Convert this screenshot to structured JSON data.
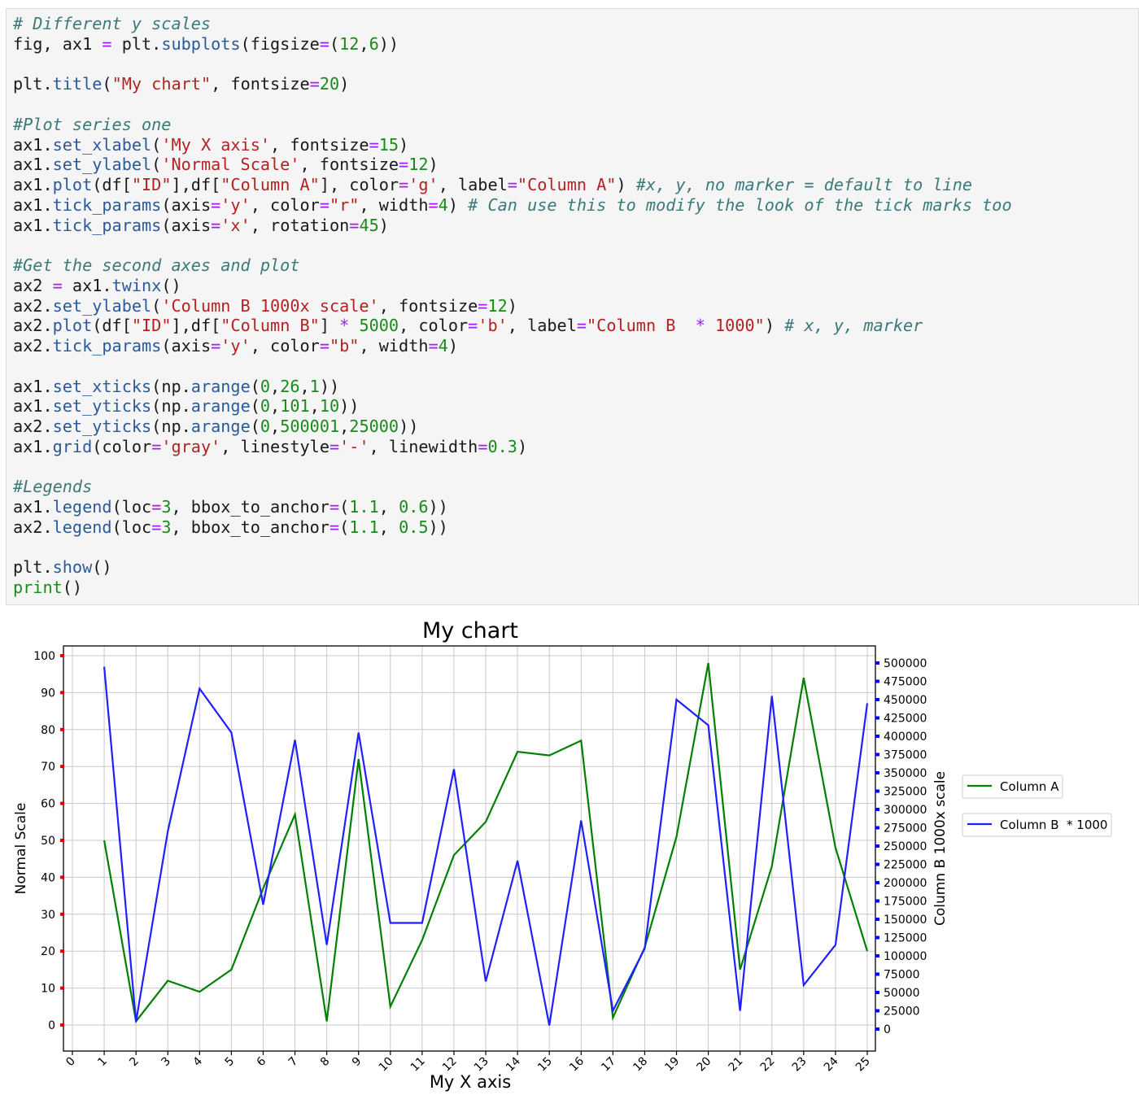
{
  "code_lines": [
    [
      [
        "cm",
        "# Different y scales"
      ]
    ],
    [
      [
        "tx",
        "fig, ax1 "
      ],
      [
        "op",
        "="
      ],
      [
        "tx",
        " plt."
      ],
      [
        "fn",
        "subplots"
      ],
      [
        "tx",
        "(figsize"
      ],
      [
        "op",
        "="
      ],
      [
        "tx",
        "("
      ],
      [
        "nm",
        "12"
      ],
      [
        "tx",
        ","
      ],
      [
        "nm",
        "6"
      ],
      [
        "tx",
        "))"
      ]
    ],
    [
      [
        "tx",
        ""
      ]
    ],
    [
      [
        "tx",
        "plt."
      ],
      [
        "fn",
        "title"
      ],
      [
        "tx",
        "("
      ],
      [
        "st",
        "\"My chart\""
      ],
      [
        "tx",
        ", fontsize"
      ],
      [
        "op",
        "="
      ],
      [
        "nm",
        "20"
      ],
      [
        "tx",
        ")"
      ]
    ],
    [
      [
        "tx",
        ""
      ]
    ],
    [
      [
        "cm",
        "#Plot series one"
      ]
    ],
    [
      [
        "tx",
        "ax1."
      ],
      [
        "fn",
        "set_xlabel"
      ],
      [
        "tx",
        "("
      ],
      [
        "st",
        "'My X axis'"
      ],
      [
        "tx",
        ", fontsize"
      ],
      [
        "op",
        "="
      ],
      [
        "nm",
        "15"
      ],
      [
        "tx",
        ")"
      ]
    ],
    [
      [
        "tx",
        "ax1."
      ],
      [
        "fn",
        "set_ylabel"
      ],
      [
        "tx",
        "("
      ],
      [
        "st",
        "'Normal Scale'"
      ],
      [
        "tx",
        ", fontsize"
      ],
      [
        "op",
        "="
      ],
      [
        "nm",
        "12"
      ],
      [
        "tx",
        ")"
      ]
    ],
    [
      [
        "tx",
        "ax1."
      ],
      [
        "fn",
        "plot"
      ],
      [
        "tx",
        "(df["
      ],
      [
        "st",
        "\"ID\""
      ],
      [
        "tx",
        "],df["
      ],
      [
        "st",
        "\"Column A\""
      ],
      [
        "tx",
        "], color"
      ],
      [
        "op",
        "="
      ],
      [
        "st",
        "'g'"
      ],
      [
        "tx",
        ", label"
      ],
      [
        "op",
        "="
      ],
      [
        "st",
        "\"Column A\""
      ],
      [
        "tx",
        ") "
      ],
      [
        "cm",
        "#x, y, no marker = default to line"
      ]
    ],
    [
      [
        "tx",
        "ax1."
      ],
      [
        "fn",
        "tick_params"
      ],
      [
        "tx",
        "(axis"
      ],
      [
        "op",
        "="
      ],
      [
        "st",
        "'y'"
      ],
      [
        "tx",
        ", color"
      ],
      [
        "op",
        "="
      ],
      [
        "st",
        "\"r\""
      ],
      [
        "tx",
        ", width"
      ],
      [
        "op",
        "="
      ],
      [
        "nm",
        "4"
      ],
      [
        "tx",
        ") "
      ],
      [
        "cm",
        "# Can use this to modify the look of the tick marks too"
      ]
    ],
    [
      [
        "tx",
        "ax1."
      ],
      [
        "fn",
        "tick_params"
      ],
      [
        "tx",
        "(axis"
      ],
      [
        "op",
        "="
      ],
      [
        "st",
        "'x'"
      ],
      [
        "tx",
        ", rotation"
      ],
      [
        "op",
        "="
      ],
      [
        "nm",
        "45"
      ],
      [
        "tx",
        ")"
      ]
    ],
    [
      [
        "tx",
        ""
      ]
    ],
    [
      [
        "cm",
        "#Get the second axes and plot"
      ]
    ],
    [
      [
        "tx",
        "ax2 "
      ],
      [
        "op",
        "="
      ],
      [
        "tx",
        " ax1."
      ],
      [
        "fn",
        "twinx"
      ],
      [
        "tx",
        "()"
      ]
    ],
    [
      [
        "tx",
        "ax2."
      ],
      [
        "fn",
        "set_ylabel"
      ],
      [
        "tx",
        "("
      ],
      [
        "st",
        "'Column B 1000x scale'"
      ],
      [
        "tx",
        ", fontsize"
      ],
      [
        "op",
        "="
      ],
      [
        "nm",
        "12"
      ],
      [
        "tx",
        ")"
      ]
    ],
    [
      [
        "tx",
        "ax2."
      ],
      [
        "fn",
        "plot"
      ],
      [
        "tx",
        "(df["
      ],
      [
        "st",
        "\"ID\""
      ],
      [
        "tx",
        "],df["
      ],
      [
        "st",
        "\"Column B\""
      ],
      [
        "tx",
        "] "
      ],
      [
        "op",
        "*"
      ],
      [
        "tx",
        " "
      ],
      [
        "nm",
        "5000"
      ],
      [
        "tx",
        ", color"
      ],
      [
        "op",
        "="
      ],
      [
        "st",
        "'b'"
      ],
      [
        "tx",
        ", label"
      ],
      [
        "op",
        "="
      ],
      [
        "st",
        "\"Column B  "
      ],
      [
        "op",
        "*"
      ],
      [
        "st",
        " 1000\""
      ],
      [
        "tx",
        ") "
      ],
      [
        "cm",
        "# x, y, marker"
      ]
    ],
    [
      [
        "tx",
        "ax2."
      ],
      [
        "fn",
        "tick_params"
      ],
      [
        "tx",
        "(axis"
      ],
      [
        "op",
        "="
      ],
      [
        "st",
        "'y'"
      ],
      [
        "tx",
        ", color"
      ],
      [
        "op",
        "="
      ],
      [
        "st",
        "\"b\""
      ],
      [
        "tx",
        ", width"
      ],
      [
        "op",
        "="
      ],
      [
        "nm",
        "4"
      ],
      [
        "tx",
        ")"
      ]
    ],
    [
      [
        "tx",
        ""
      ]
    ],
    [
      [
        "tx",
        "ax1."
      ],
      [
        "fn",
        "set_xticks"
      ],
      [
        "tx",
        "(np."
      ],
      [
        "fn",
        "arange"
      ],
      [
        "tx",
        "("
      ],
      [
        "nm",
        "0"
      ],
      [
        "tx",
        ","
      ],
      [
        "nm",
        "26"
      ],
      [
        "tx",
        ","
      ],
      [
        "nm",
        "1"
      ],
      [
        "tx",
        "))"
      ]
    ],
    [
      [
        "tx",
        "ax1."
      ],
      [
        "fn",
        "set_yticks"
      ],
      [
        "tx",
        "(np."
      ],
      [
        "fn",
        "arange"
      ],
      [
        "tx",
        "("
      ],
      [
        "nm",
        "0"
      ],
      [
        "tx",
        ","
      ],
      [
        "nm",
        "101"
      ],
      [
        "tx",
        ","
      ],
      [
        "nm",
        "10"
      ],
      [
        "tx",
        "))"
      ]
    ],
    [
      [
        "tx",
        "ax2."
      ],
      [
        "fn",
        "set_yticks"
      ],
      [
        "tx",
        "(np."
      ],
      [
        "fn",
        "arange"
      ],
      [
        "tx",
        "("
      ],
      [
        "nm",
        "0"
      ],
      [
        "tx",
        ","
      ],
      [
        "nm",
        "500001"
      ],
      [
        "tx",
        ","
      ],
      [
        "nm",
        "25000"
      ],
      [
        "tx",
        "))"
      ]
    ],
    [
      [
        "tx",
        "ax1."
      ],
      [
        "fn",
        "grid"
      ],
      [
        "tx",
        "(color"
      ],
      [
        "op",
        "="
      ],
      [
        "st",
        "'gray'"
      ],
      [
        "tx",
        ", linestyle"
      ],
      [
        "op",
        "="
      ],
      [
        "st",
        "'-'"
      ],
      [
        "tx",
        ", linewidth"
      ],
      [
        "op",
        "="
      ],
      [
        "nm",
        "0.3"
      ],
      [
        "tx",
        ")"
      ]
    ],
    [
      [
        "tx",
        ""
      ]
    ],
    [
      [
        "cm",
        "#Legends"
      ]
    ],
    [
      [
        "tx",
        "ax1."
      ],
      [
        "fn",
        "legend"
      ],
      [
        "tx",
        "(loc"
      ],
      [
        "op",
        "="
      ],
      [
        "nm",
        "3"
      ],
      [
        "tx",
        ", bbox_to_anchor"
      ],
      [
        "op",
        "="
      ],
      [
        "tx",
        "("
      ],
      [
        "nm",
        "1.1"
      ],
      [
        "tx",
        ", "
      ],
      [
        "nm",
        "0.6"
      ],
      [
        "tx",
        "))"
      ]
    ],
    [
      [
        "tx",
        "ax2."
      ],
      [
        "fn",
        "legend"
      ],
      [
        "tx",
        "(loc"
      ],
      [
        "op",
        "="
      ],
      [
        "nm",
        "3"
      ],
      [
        "tx",
        ", bbox_to_anchor"
      ],
      [
        "op",
        "="
      ],
      [
        "tx",
        "("
      ],
      [
        "nm",
        "1.1"
      ],
      [
        "tx",
        ", "
      ],
      [
        "nm",
        "0.5"
      ],
      [
        "tx",
        "))"
      ]
    ],
    [
      [
        "tx",
        ""
      ]
    ],
    [
      [
        "tx",
        "plt."
      ],
      [
        "fn",
        "show"
      ],
      [
        "tx",
        "()"
      ]
    ],
    [
      [
        "kw",
        "print"
      ],
      [
        "tx",
        "()"
      ]
    ]
  ],
  "colors": {
    "series_a": "#008000",
    "series_b": "#1f1fff",
    "tick_left": "#e00000",
    "tick_right": "#0000ff",
    "grid": "#c8c8c8"
  },
  "chart_data": {
    "type": "line",
    "title": "My chart",
    "xlabel": "My X axis",
    "ylabel": "Normal Scale",
    "ylabel_right": "Column B 1000x scale",
    "xlim": [
      0,
      25
    ],
    "ylim": [
      0,
      100
    ],
    "ylim_right": [
      0,
      500000
    ],
    "x_ticks": [
      "0",
      "1",
      "2",
      "3",
      "4",
      "5",
      "6",
      "7",
      "8",
      "9",
      "10",
      "11",
      "12",
      "13",
      "14",
      "15",
      "16",
      "17",
      "18",
      "19",
      "20",
      "21",
      "22",
      "23",
      "24",
      "25"
    ],
    "y_ticks": [
      "0",
      "10",
      "20",
      "30",
      "40",
      "50",
      "60",
      "70",
      "80",
      "90",
      "100"
    ],
    "y_ticks_right": [
      "0",
      "25000",
      "50000",
      "75000",
      "100000",
      "125000",
      "150000",
      "175000",
      "200000",
      "225000",
      "250000",
      "275000",
      "300000",
      "325000",
      "350000",
      "375000",
      "400000",
      "425000",
      "450000",
      "475000",
      "500000"
    ],
    "grid": true,
    "legend_placement": "right, outside plot",
    "x": [
      1,
      2,
      3,
      4,
      5,
      6,
      7,
      8,
      9,
      10,
      11,
      12,
      13,
      14,
      15,
      16,
      17,
      18,
      19,
      20,
      21,
      22,
      23,
      24,
      25
    ],
    "series": [
      {
        "name": "Column A",
        "axis": "left",
        "color": "#008000",
        "values": [
          50,
          1,
          12,
          9,
          15,
          37,
          57,
          1,
          72,
          5,
          23,
          46,
          55,
          74,
          73,
          77,
          2,
          21,
          51,
          98,
          15,
          43,
          94,
          48,
          20
        ]
      },
      {
        "name": "Column B  * 1000",
        "axis": "right",
        "color": "#1f1fff",
        "values": [
          495000,
          10000,
          270000,
          465000,
          405000,
          170000,
          395000,
          115000,
          405000,
          145000,
          145000,
          355000,
          65000,
          230000,
          5000,
          285000,
          25000,
          110000,
          450000,
          415000,
          25000,
          455000,
          60000,
          115000,
          445000
        ]
      }
    ]
  }
}
